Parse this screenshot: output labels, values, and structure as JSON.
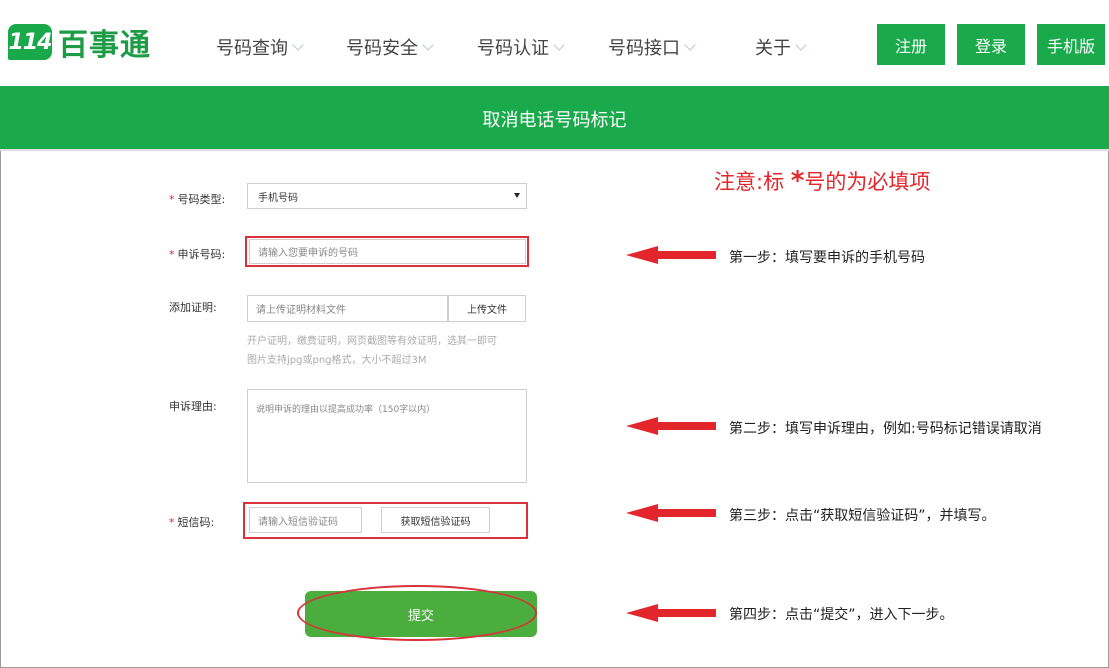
{
  "brand": {
    "badge": "114",
    "name": "百事通"
  },
  "nav": [
    {
      "label": "号码查询"
    },
    {
      "label": "号码安全"
    },
    {
      "label": "号码认证"
    },
    {
      "label": "号码接口"
    },
    {
      "label": "关于"
    }
  ],
  "header_buttons": {
    "register": "注册",
    "login": "登录",
    "mobile": "手机版"
  },
  "banner": {
    "title": "取消电话号码标记"
  },
  "notice": {
    "prefix": "注意:标 ",
    "star": "*",
    "suffix": "号的为必填项"
  },
  "form": {
    "required_mark": "*",
    "number_type": {
      "label": "号码类型:",
      "value": "手机号码"
    },
    "complaint_number": {
      "label": "申诉号码:",
      "placeholder": "请输入您要申诉的号码"
    },
    "evidence": {
      "label": "添加证明:",
      "placeholder": "请上传证明材料文件",
      "button": "上传文件",
      "hint_line1": "开户证明，缴费证明，网页截图等有效证明，选其一即可",
      "hint_line2": "图片支持jpg或png格式，大小不超过3M"
    },
    "reason": {
      "label": "申诉理由:",
      "placeholder": "说明申诉的理由以提高成功率（150字以内）"
    },
    "sms": {
      "label": "短信码:",
      "placeholder": "请输入短信验证码",
      "button": "获取短信验证码"
    },
    "submit": "提交"
  },
  "steps": [
    "第一步：填写要申诉的手机号码",
    "第二步：填写申诉理由，例如:号码标记错误请取消",
    "第三步：点击“获取短信验证码”，并填写。",
    "第四步：点击“提交”，进入下一步。"
  ],
  "colors": {
    "brand_green": "#1aaa4b",
    "annotation_red": "#d9323a",
    "submit_green": "#4aad3d"
  },
  "icons": {
    "arrow": "left-arrow-icon",
    "chevron": "chevron-down-icon"
  }
}
